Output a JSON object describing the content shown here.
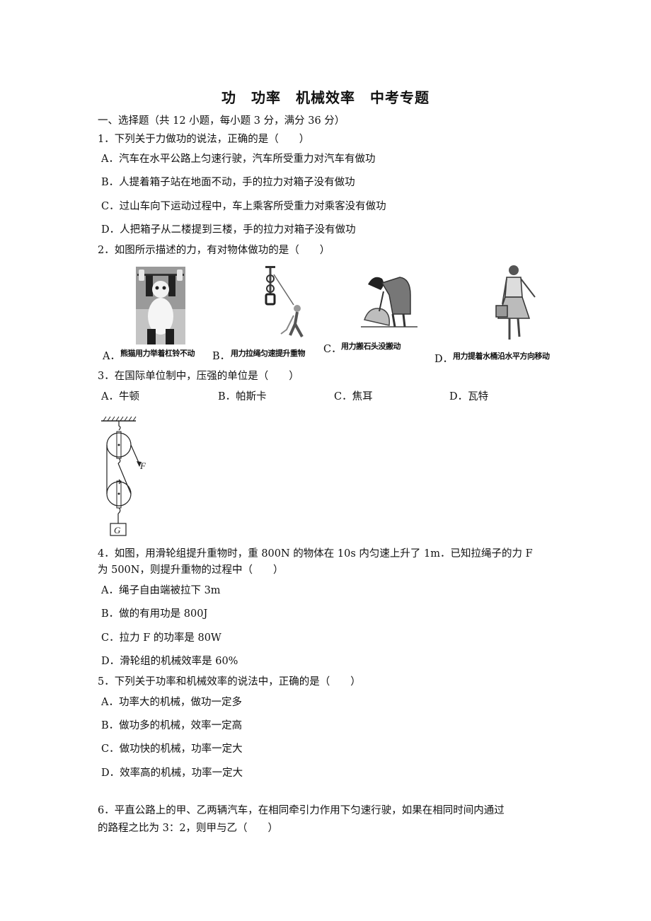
{
  "document": {
    "title": "功　功率　机械效率　中考专题",
    "section": "一、选择题（共 12 小题，每小题 3 分，满分 36 分）"
  },
  "questions": [
    {
      "stem": "1．下列关于力做功的说法，正确的是（　　）",
      "options": [
        "A．汽车在水平公路上匀速行驶，汽车所受重力对汽车有做功",
        "B．人提着箱子站在地面不动，手的拉力对箱子没有做功",
        "C．过山车向下运动过程中，车上乘客所受重力对乘客没有做功",
        "D．人把箱子从二楼提到三楼，手的拉力对箱子没有做功"
      ]
    },
    {
      "stem": "2．如图所示描述的力，有对物体做功的是（　　）",
      "figures": [
        {
          "label": "A．",
          "caption": "熊猫用力举着杠铃不动",
          "icon": "panda-lifting-barbell-image"
        },
        {
          "label": "B．",
          "caption": "用力拉绳匀速提升重物",
          "icon": "man-pulling-rope-image"
        },
        {
          "label": "C．",
          "caption": "用力搬石头没搬动",
          "icon": "girl-pushing-rock-image"
        },
        {
          "label": "D．",
          "caption": "用力提着水桶沿水平方向移动",
          "icon": "girl-carrying-bucket-image"
        }
      ]
    },
    {
      "stem": "3．在国际单位制中，压强的单位是（　　）",
      "options": [
        "A．牛顿",
        "B．帕斯卡",
        "C．焦耳",
        "D．瓦特"
      ]
    },
    {
      "figure": {
        "icon": "pulley-system-diagram",
        "force_label": "F",
        "weight_label": "G"
      },
      "stem_lines": [
        "4．如图，用滑轮组提升重物时，重 800N 的物体在 10s 内匀速上升了 1m．已知拉绳子的力 F",
        "为 500N，则提升重物的过程中（　　）"
      ],
      "options": [
        "A．绳子自由端被拉下 3m",
        "B．做的有用功是 800J",
        "C．拉力 F 的功率是 80W",
        "D．滑轮组的机械效率是 60%"
      ]
    },
    {
      "stem": "5．下列关于功率和机械效率的说法中，正确的是（　　）",
      "options": [
        "A．功率大的机械，做功一定多",
        "B．做功多的机械，效率一定高",
        "C．做功快的机械，功率一定大",
        "D．效率高的机械，功率一定大"
      ]
    },
    {
      "stem_lines": [
        "6．平直公路上的甲、乙两辆汽车，在相同牵引力作用下匀速行驶，如果在相同时间内通过",
        "的路程之比为 3：2，则甲与乙（　　）"
      ]
    }
  ]
}
